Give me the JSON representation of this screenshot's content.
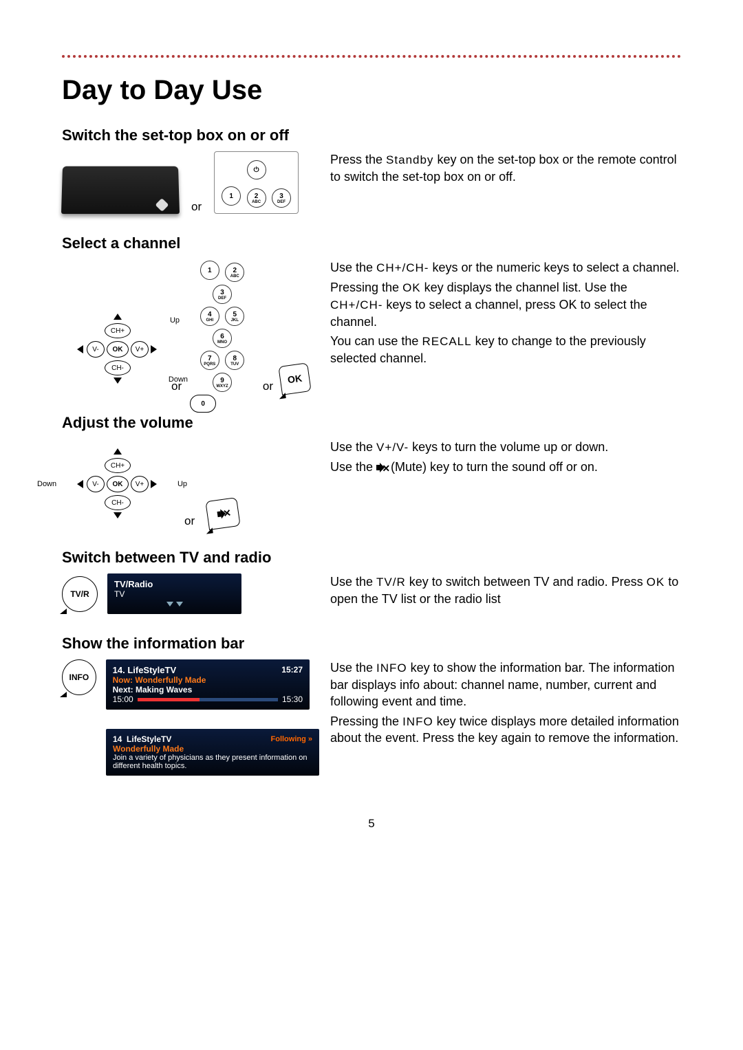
{
  "page_number": "5",
  "title": "Day to Day Use",
  "labels": {
    "or": "or"
  },
  "keypad": {
    "k1": "1",
    "k2": "2",
    "k2s": "ABC",
    "k3": "3",
    "k3s": "DEF",
    "k4": "4",
    "k4s": "GHI",
    "k5": "5",
    "k5s": "JKL",
    "k6": "6",
    "k6s": "MNO",
    "k7": "7",
    "k7s": "PQRS",
    "k8": "8",
    "k8s": "TUV",
    "k9": "9",
    "k9s": "WXYZ",
    "k0": "0"
  },
  "dpad": {
    "ok": "OK",
    "chp": "CH+",
    "chm": "CH-",
    "vp": "V+",
    "vm": "V-",
    "up": "Up",
    "down": "Down"
  },
  "okbtn": "OK",
  "tvr_btn": "TV/R",
  "info_btn": "INFO",
  "sections": {
    "standby": {
      "heading": "Switch the set-top box on or off",
      "p1a": "Press the ",
      "key": "Standby",
      "p1b": " key on the set-top box or the remote control to switch the set-top box on or off."
    },
    "channel": {
      "heading": "Select a channel",
      "p1a": "Use the ",
      "k1": "CH+/CH-",
      "p1b": " keys or the numeric keys to select a channel.",
      "p2a": "Pressing the ",
      "k2": "OK",
      "p2b": " key displays the channel list. Use the ",
      "k3": "CH+/CH-",
      "p2c": " keys to select a channel, press OK to select the channel.",
      "p3a": "You can use the ",
      "k4": "RECALL",
      "p3b": " key to change to the previously selected channel."
    },
    "volume": {
      "heading": "Adjust the volume",
      "p1a": "Use the ",
      "k1": "V+/V-",
      "p1b": " keys to turn the volume up or down.",
      "p2a": "Use the ",
      "p2b": " (Mute) key to turn the sound off or on."
    },
    "tvradio": {
      "heading": "Switch between TV and radio",
      "p1a": "Use the ",
      "k1": "TV/R",
      "p1b": " key to switch between TV and radio. Press ",
      "k2": "OK",
      "p1c": " to open the TV list or the radio list",
      "osd_title": "TV/Radio",
      "osd_mode": "TV"
    },
    "info": {
      "heading": "Show the information bar",
      "p1a": "Use the ",
      "k1": "INFO",
      "p1b": " key to show the information bar. The information bar displays info about: channel name, number, current and following event and time.",
      "p2a": "Pressing the ",
      "k2": "INFO",
      "p2b": " key twice displays more detailed information about the event. Press the key again to remove the information.",
      "osd1": {
        "chan": "14. LifeStyleTV",
        "now_lbl": "Now:",
        "now": "Wonderfully Made",
        "next_lbl": "Next:",
        "next": "Making Waves",
        "t1": "15:00",
        "t2": "15:30",
        "clock": "15:27"
      },
      "osd2": {
        "num": "14",
        "chan": "LifeStyleTV",
        "follow": "Following »",
        "prog": "Wonderfully Made",
        "desc": "Join a variety of physicians as they present information on different health topics."
      }
    }
  }
}
